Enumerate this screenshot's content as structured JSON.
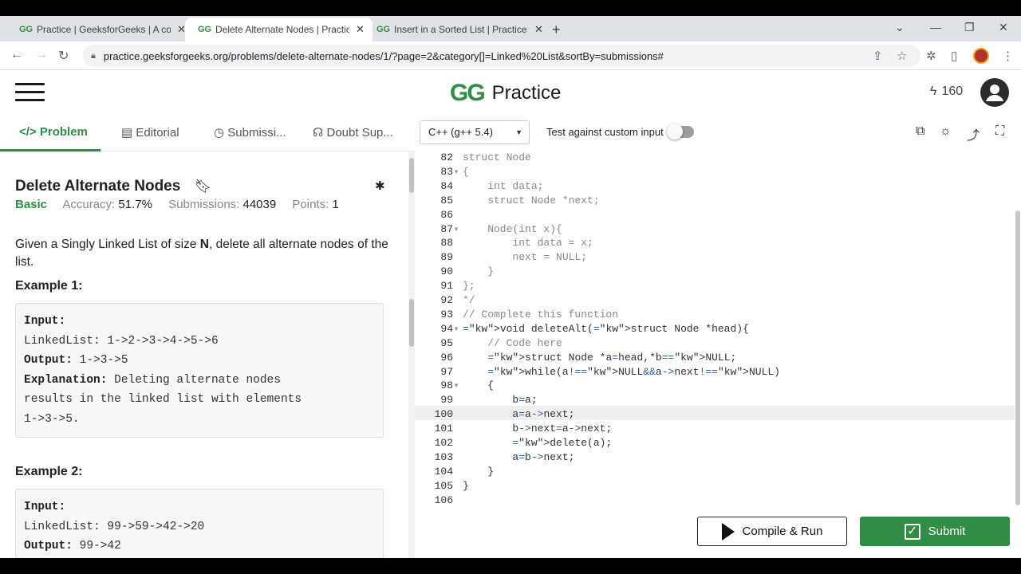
{
  "browser": {
    "tabs": [
      {
        "title": "Practice | GeeksforGeeks | A com",
        "favicon": "gfg-favicon"
      },
      {
        "title": "Delete Alternate Nodes | Practice",
        "favicon": "gfg-favicon"
      },
      {
        "title": "Insert in a Sorted List | Practice |",
        "favicon": "gfg-favicon"
      }
    ],
    "url": "practice.geeksforgeeks.org/problems/delete-alternate-nodes/1/?page=2&category[]=Linked%20List&sortBy=submissions#"
  },
  "header": {
    "brand_logo": "GG",
    "brand_word": "Practice",
    "streak_count": "160"
  },
  "problem_tabs": {
    "problem": "Problem",
    "editorial": "Editorial",
    "submissions": "Submissi...",
    "doubt": "Doubt Sup..."
  },
  "editor_toolbar": {
    "language": "C++ (g++ 5.4)",
    "custom_input_label": "Test against custom input"
  },
  "problem": {
    "title": "Delete Alternate Nodes",
    "difficulty": "Basic",
    "accuracy_label": "Accuracy:",
    "accuracy": "51.7%",
    "submissions_label": "Submissions:",
    "submissions": "44039",
    "points_label": "Points:",
    "points": "1",
    "desc_pre": "Given a Singly Linked List of size ",
    "desc_n": "N",
    "desc_post": ", delete all alternate nodes of the list.",
    "example1_title": "Example 1:",
    "example1": {
      "input_label": "Input:",
      "input": "LinkedList: 1->2->3->4->5->6",
      "output_label": "Output:",
      "output": " 1->3->5",
      "explanation_label": "Explanation:",
      "explanation_1": " Deleting alternate nodes",
      "explanation_2": "results in the linked list with elements",
      "explanation_3": "1->3->5."
    },
    "example2_title": "Example 2:",
    "example2": {
      "input_label": "Input:",
      "input": "LinkedList: 99->59->42->20",
      "output_label": "Output:",
      "output": " 99->42"
    }
  },
  "code_lines": [
    {
      "n": "82",
      "t": "struct Node"
    },
    {
      "n": "83",
      "t": "{"
    },
    {
      "n": "84",
      "t": "    int data;"
    },
    {
      "n": "85",
      "t": "    struct Node *next;"
    },
    {
      "n": "86",
      "t": ""
    },
    {
      "n": "87",
      "t": "    Node(int x){"
    },
    {
      "n": "88",
      "t": "        int data = x;"
    },
    {
      "n": "89",
      "t": "        next = NULL;"
    },
    {
      "n": "90",
      "t": "    }"
    },
    {
      "n": "91",
      "t": "};"
    },
    {
      "n": "92",
      "t": "*/"
    },
    {
      "n": "93",
      "t": "// Complete this function"
    },
    {
      "n": "94",
      "t": "void deleteAlt(struct Node *head){"
    },
    {
      "n": "95",
      "t": "    // Code here"
    },
    {
      "n": "96",
      "t": "    struct Node *a=head,*b=NULL;"
    },
    {
      "n": "97",
      "t": "    while(a!=NULL&&a->next!=NULL)"
    },
    {
      "n": "98",
      "t": "    {"
    },
    {
      "n": "99",
      "t": "        b=a;"
    },
    {
      "n": "100",
      "t": "        a=a->next;"
    },
    {
      "n": "101",
      "t": "        b->next=a->next;"
    },
    {
      "n": "102",
      "t": "        delete(a);"
    },
    {
      "n": "103",
      "t": "        a=b->next;"
    },
    {
      "n": "104",
      "t": "    }"
    },
    {
      "n": "105",
      "t": "}"
    },
    {
      "n": "106",
      "t": ""
    }
  ],
  "actions": {
    "compile_run": "Compile & Run",
    "submit": "Submit"
  },
  "colors": {
    "brand_green": "#2f8d46",
    "keyword_purple": "#7b1fa2",
    "comment_gray": "#888888"
  }
}
